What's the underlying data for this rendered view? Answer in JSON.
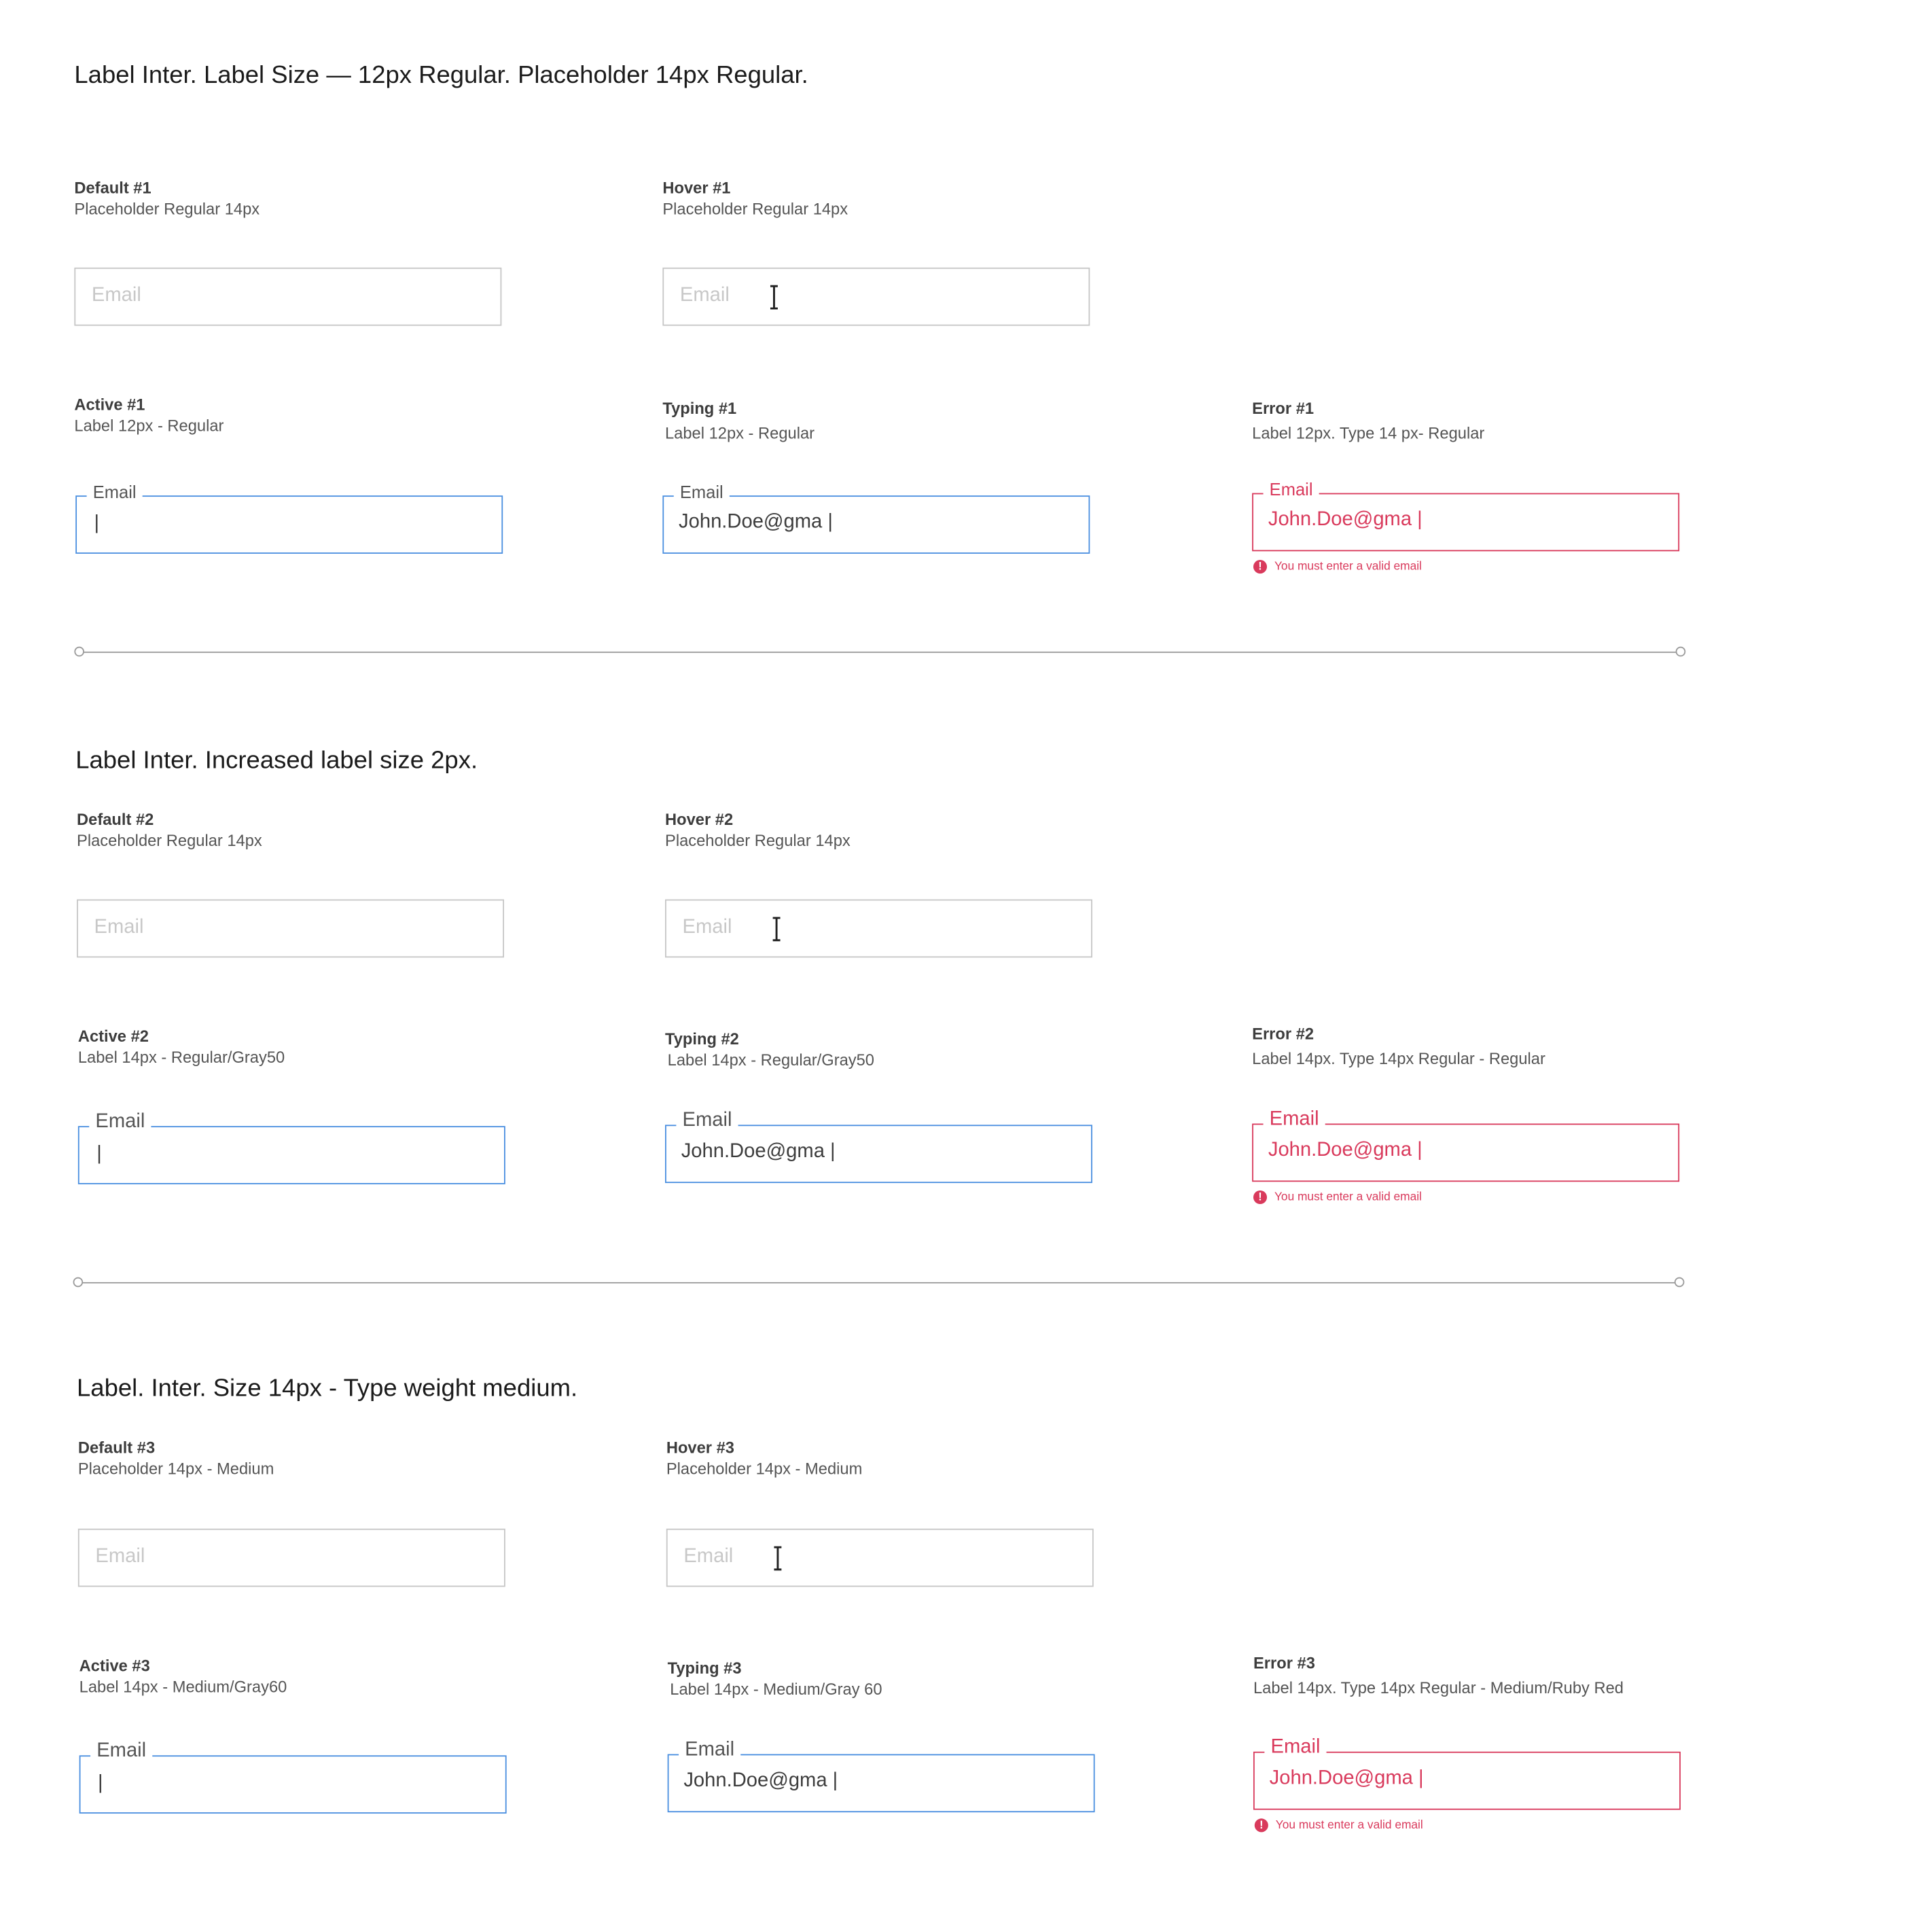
{
  "colors": {
    "accent_blue": "#4a8fe0",
    "error_red": "#d93a5c",
    "border_gray": "#c6c6c6",
    "placeholder_gray": "#c8c8c8"
  },
  "icons": {
    "hover_cursor": "text-cursor-icon",
    "error": "alert-circle-icon"
  },
  "section1": {
    "title": "Label Inter. Label Size — 12px Regular. Placeholder 14px Regular.",
    "default": {
      "title": "Default #1",
      "desc": "Placeholder Regular 14px",
      "placeholder": "Email"
    },
    "hover": {
      "title": "Hover #1",
      "desc": "Placeholder Regular 14px",
      "placeholder": "Email"
    },
    "active": {
      "title": "Active #1",
      "desc": "Label 12px - Regular",
      "label": "Email",
      "cursor": "|"
    },
    "typing": {
      "title": "Typing #1",
      "desc": "Label 12px - Regular",
      "label": "Email",
      "value": "John.Doe@gma |"
    },
    "error": {
      "title": "Error #1",
      "desc": "Label 12px. Type 14 px- Regular",
      "label": "Email",
      "value": "John.Doe@gma |",
      "message": "You must enter a valid email",
      "icon_glyph": "!"
    }
  },
  "section2": {
    "title": "Label Inter. Increased label size 2px.",
    "default": {
      "title": "Default #2",
      "desc": "Placeholder Regular 14px",
      "placeholder": "Email"
    },
    "hover": {
      "title": "Hover #2",
      "desc": "Placeholder Regular 14px",
      "placeholder": "Email"
    },
    "active": {
      "title": "Active #2",
      "desc": "Label 14px - Regular/Gray50",
      "label": "Email",
      "cursor": "|"
    },
    "typing": {
      "title": "Typing #2",
      "desc": "Label 14px - Regular/Gray50",
      "label": "Email",
      "value": "John.Doe@gma |"
    },
    "error": {
      "title": "Error #2",
      "desc": "Label 14px. Type 14px Regular - Regular",
      "label": "Email",
      "value": "John.Doe@gma |",
      "message": "You must enter a valid email",
      "icon_glyph": "!"
    }
  },
  "section3": {
    "title": "Label. Inter. Size 14px - Type weight medium.",
    "default": {
      "title": "Default #3",
      "desc": "Placeholder 14px - Medium",
      "placeholder": "Email"
    },
    "hover": {
      "title": "Hover #3",
      "desc": "Placeholder 14px -  Medium",
      "placeholder": "Email"
    },
    "active": {
      "title": "Active #3",
      "desc": "Label 14px - Medium/Gray60",
      "label": "Email",
      "cursor": "|"
    },
    "typing": {
      "title": "Typing #3",
      "desc": "Label 14px - Medium/Gray 60",
      "label": "Email",
      "value": "John.Doe@gma |"
    },
    "error": {
      "title": "Error #3",
      "desc": "Label 14px. Type 14px Regular - Medium/Ruby Red",
      "label": "Email",
      "value": "John.Doe@gma |",
      "message": "You must enter a valid email",
      "icon_glyph": "!"
    }
  }
}
